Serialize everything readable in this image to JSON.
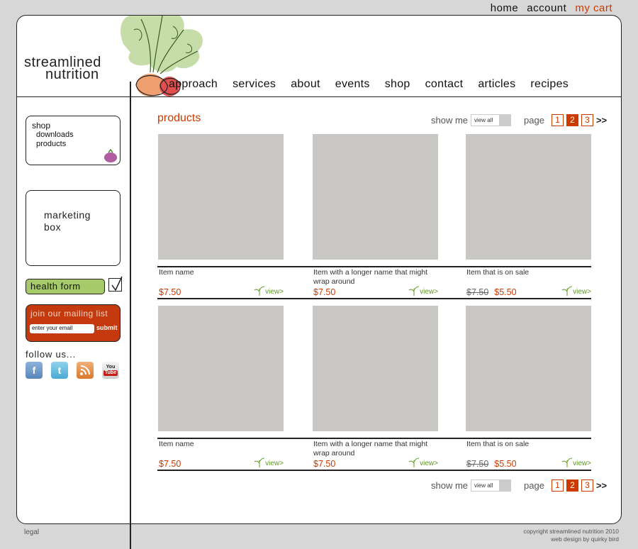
{
  "topnav": {
    "home": "home",
    "account": "account",
    "cart": "my cart"
  },
  "logo": {
    "line1": "streamlined",
    "line2": "nutrition"
  },
  "mainnav": [
    "approach",
    "services",
    "about",
    "events",
    "shop",
    "contact",
    "articles",
    "recipes"
  ],
  "subnav": {
    "title": "shop",
    "items": [
      "downloads",
      "products"
    ]
  },
  "marketing": {
    "line1": "marketing",
    "line2": "box"
  },
  "health_form": "health form",
  "mailing": {
    "title": "join our mailing list",
    "placeholder": "enter your email",
    "submit": "submit"
  },
  "follow": "follow us...",
  "social": {
    "youtube_top": "You",
    "youtube_bottom": "Tube"
  },
  "products": {
    "title": "products",
    "show_me": "show me",
    "show_value": "view all",
    "page_label": "page",
    "pages": [
      "1",
      "2",
      "3"
    ],
    "active_page": "2",
    "next": ">>",
    "view_label": "view>",
    "items": [
      {
        "name": "Item name",
        "price": "$7.50",
        "old_price": ""
      },
      {
        "name": "Item with a longer name that might wrap around",
        "price": "$7.50",
        "old_price": ""
      },
      {
        "name": "Item that is on sale",
        "price": "$5.50",
        "old_price": "$7.50"
      },
      {
        "name": "Item name",
        "price": "$7.50",
        "old_price": ""
      },
      {
        "name": "Item with a longer name that might wrap around",
        "price": "$7.50",
        "old_price": ""
      },
      {
        "name": "Item that is on sale",
        "price": "$5.50",
        "old_price": "$7.50"
      }
    ]
  },
  "footer": {
    "legal": "legal",
    "copyright": "copyright streamlined nutrition 2010",
    "credit": "web design by quirky bird"
  },
  "colors": {
    "accent": "#cc3a00",
    "green": "#a6c96a",
    "view_green": "#5d9a1d",
    "placeholder_gray": "#c8c7c3"
  }
}
